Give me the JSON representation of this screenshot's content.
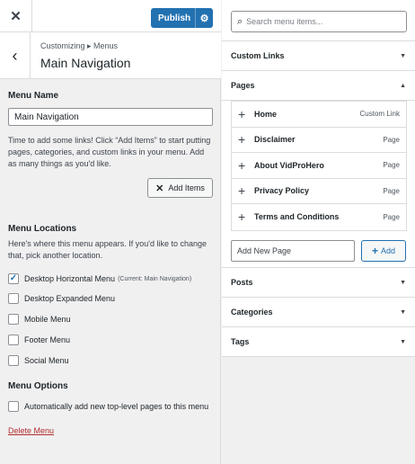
{
  "topbar": {
    "close_icon": "close-icon",
    "publish_label": "Publish",
    "gear_icon": "gear-icon"
  },
  "header": {
    "breadcrumb": "Customizing ▸ Menus",
    "title": "Main Navigation",
    "back_icon": "chevron-left-icon"
  },
  "menu_name": {
    "label": "Menu Name",
    "value": "Main Navigation",
    "help": "Time to add some links! Click “Add Items” to start putting pages, categories, and custom links in your menu. Add as many things as you'd like.",
    "add_items_label": "Add Items"
  },
  "locations": {
    "heading": "Menu Locations",
    "help": "Here's where this menu appears. If you'd like to change that, pick another location.",
    "items": [
      {
        "label": "Desktop Horizontal Menu",
        "note": "(Current: Main Navigation)",
        "checked": true
      },
      {
        "label": "Desktop Expanded Menu",
        "note": "",
        "checked": false
      },
      {
        "label": "Mobile Menu",
        "note": "",
        "checked": false
      },
      {
        "label": "Footer Menu",
        "note": "",
        "checked": false
      },
      {
        "label": "Social Menu",
        "note": "",
        "checked": false
      }
    ]
  },
  "options": {
    "heading": "Menu Options",
    "auto_add_label": "Automatically add new top-level pages to this menu",
    "auto_add_checked": false
  },
  "delete_label": "Delete Menu",
  "search": {
    "placeholder": "Search menu items..."
  },
  "panels": {
    "custom_links": "Custom Links",
    "pages": "Pages",
    "posts": "Posts",
    "categories": "Categories",
    "tags": "Tags"
  },
  "pages_list": [
    {
      "name": "Home",
      "type": "Custom Link"
    },
    {
      "name": "Disclaimer",
      "type": "Page"
    },
    {
      "name": "About VidProHero",
      "type": "Page"
    },
    {
      "name": "Privacy Policy",
      "type": "Page"
    },
    {
      "name": "Terms and Conditions",
      "type": "Page"
    }
  ],
  "new_page": {
    "placeholder": "Add New Page",
    "add_label": "Add"
  },
  "colors": {
    "accent": "#2271b1",
    "danger": "#b32d2e",
    "panel": "#f0f0f1"
  }
}
